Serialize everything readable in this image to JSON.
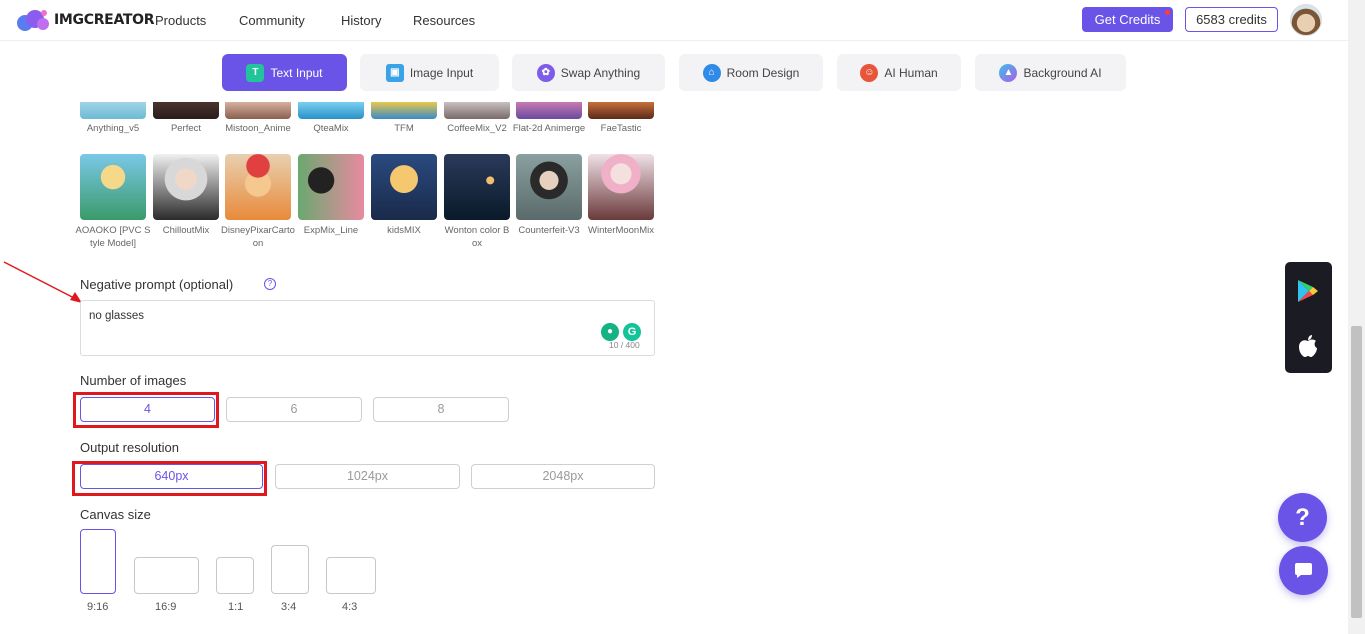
{
  "header": {
    "brand": "IMGCREATOR",
    "nav": [
      "Products",
      "Community",
      "History",
      "Resources"
    ],
    "get_credits": "Get Credits",
    "credits": "6583 credits"
  },
  "modes": [
    {
      "label": "Text Input",
      "icon": "text-input-icon",
      "color": "#ffffff"
    },
    {
      "label": "Image Input",
      "icon": "image-input-icon",
      "color": "#3aa3e8"
    },
    {
      "label": "Swap Anything",
      "icon": "swap-icon",
      "color": "#7c5ce8"
    },
    {
      "label": "Room Design",
      "icon": "room-icon",
      "color": "#2f8ae8"
    },
    {
      "label": "AI Human",
      "icon": "human-icon",
      "color": "#e8553a"
    },
    {
      "label": "Background AI",
      "icon": "background-icon",
      "color": "#8a5ce8"
    }
  ],
  "models_row1": [
    "Anything_v5",
    "Perfect",
    "Mistoon_Anime",
    "QteaMix",
    "TFM",
    "CoffeeMix_V2",
    "Flat-2d Animerge",
    "FaeTastic"
  ],
  "models_row2": [
    "AOAOKO [PVC Style Model]",
    "ChilloutMix",
    "DisneyPixarCartoon",
    "ExpMix_Line",
    "kidsMIX",
    "Wonton color Box",
    "Counterfeit-V3",
    "WinterMoonMix"
  ],
  "negative_prompt": {
    "label": "Negative prompt (optional)",
    "value": "no glasses",
    "counter": "10 / 400"
  },
  "number_of_images": {
    "label": "Number of images",
    "options": [
      "4",
      "6",
      "8"
    ],
    "selected": "4"
  },
  "output_resolution": {
    "label": "Output resolution",
    "options": [
      "640px",
      "1024px",
      "2048px"
    ],
    "selected": "640px"
  },
  "canvas_size": {
    "label": "Canvas size",
    "options": [
      "9:16",
      "16:9",
      "1:1",
      "3:4",
      "4:3"
    ],
    "selected": "9:16"
  },
  "colors": {
    "accent": "#6a54e8",
    "highlight": "#e0181e"
  }
}
